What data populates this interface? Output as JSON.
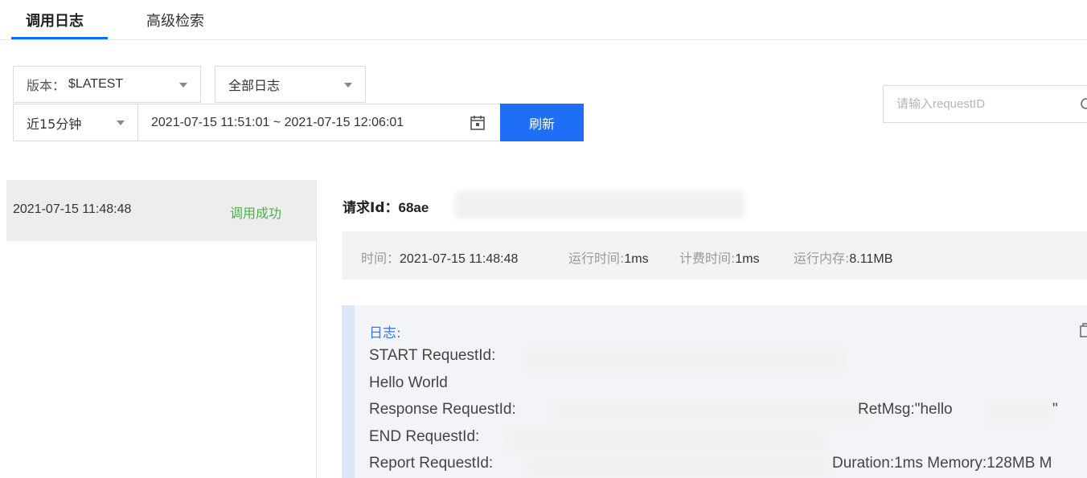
{
  "tabs": [
    {
      "label": "调用日志",
      "active": true
    },
    {
      "label": "高级检索",
      "active": false
    }
  ],
  "filters": {
    "version_label": "版本：",
    "version_value": "$LATEST",
    "log_type": "全部日志",
    "time_preset": "近15分钟",
    "date_range": "2021-07-15 11:51:01 ~ 2021-07-15 12:06:01",
    "refresh_label": "刷新",
    "search_placeholder": "请输入requestID"
  },
  "log_list": [
    {
      "time": "2021-07-15 11:48:48",
      "status": "调用成功"
    }
  ],
  "detail": {
    "request_id_label": "请求Id：",
    "request_id_value": "68ae",
    "time_label": "时间：",
    "time_value": "2021-07-15 11:48:48",
    "run_time_label": "运行时间:",
    "run_time_value": "1ms",
    "bill_time_label": "计费时间:",
    "bill_time_value": "1ms",
    "memory_label": "运行内存:",
    "memory_value": "8.11MB",
    "log_title": "日志:",
    "log_lines": [
      "START RequestId:",
      "Hello World",
      "Response RequestId:",
      "RetMsg:\"hello",
      "\"",
      "END RequestId:",
      "Report RequestId:",
      "Duration:1ms Memory:128MB M"
    ]
  },
  "colors": {
    "accent": "#1e6ff5",
    "success": "#4caf50",
    "log_title": "#3a7ad8"
  }
}
